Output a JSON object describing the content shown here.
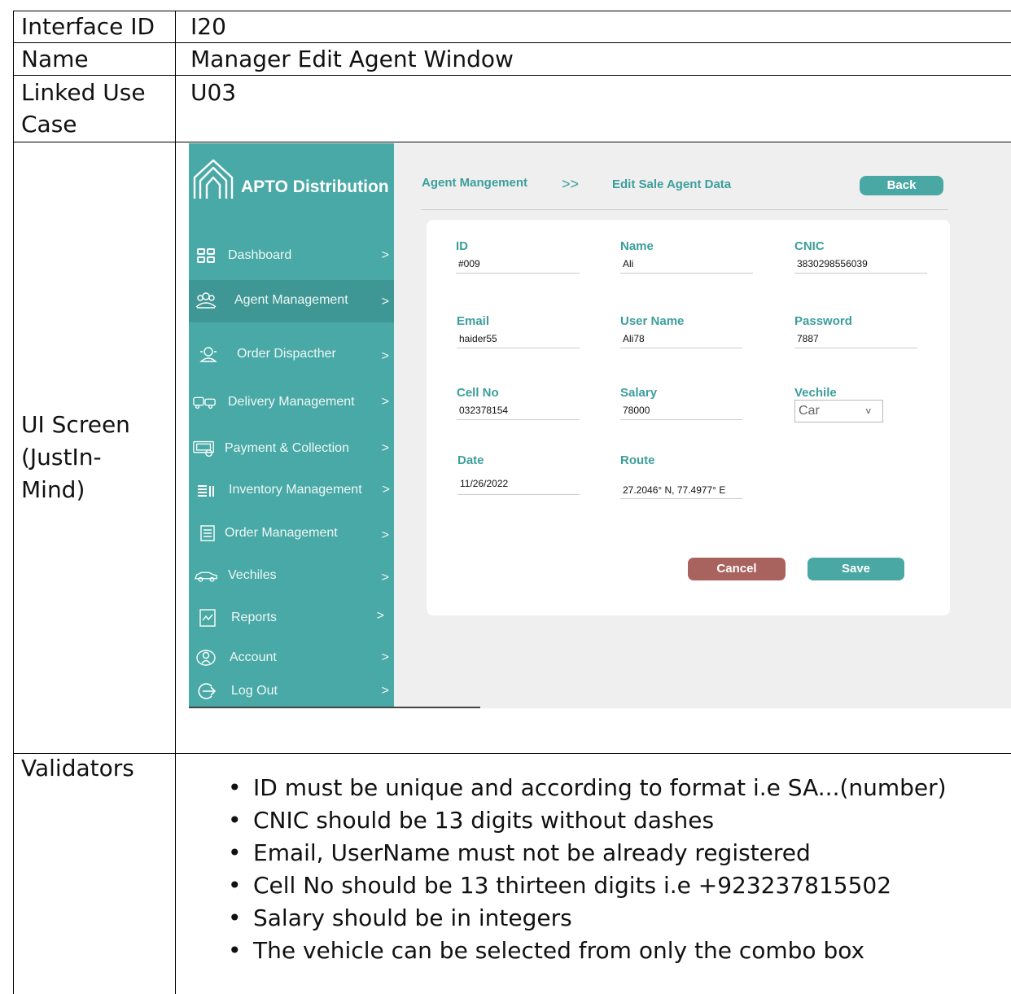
{
  "table": {
    "rows": [
      {
        "label": "Interface ID",
        "value": "I20"
      },
      {
        "label": "Name",
        "value": "Manager Edit Agent Window"
      },
      {
        "label_lines": [
          "Linked Use",
          "Case"
        ],
        "value": "U03"
      },
      {
        "label_lines": [
          "UI Screen",
          "(JustIn-",
          "Mind)"
        ]
      },
      {
        "label": "Validators"
      }
    ]
  },
  "app": {
    "brand": "APTO Distribution",
    "nav": [
      {
        "label": "Dashboard",
        "chevron": ">",
        "icon": "dashboard-icon"
      },
      {
        "label": "Agent Management",
        "chevron": ">",
        "icon": "agents-icon",
        "active": true
      },
      {
        "label": "Order Dispacther",
        "chevron": ">",
        "icon": "dispatcher-icon"
      },
      {
        "label": "Delivery Management",
        "chevron": ">",
        "icon": "delivery-icon"
      },
      {
        "label": "Payment & Collection",
        "chevron": ">",
        "icon": "payment-icon"
      },
      {
        "label": "Inventory Management",
        "chevron": ">",
        "icon": "inventory-icon"
      },
      {
        "label": "Order Management",
        "chevron": ">",
        "icon": "orders-icon"
      },
      {
        "label": "Vechiles",
        "chevron": ">",
        "icon": "car-icon"
      },
      {
        "label": "Reports",
        "chevron": ">",
        "icon": "reports-icon"
      },
      {
        "label": "Account",
        "chevron": ">",
        "icon": "account-icon"
      },
      {
        "label": "Log Out",
        "chevron": ">",
        "icon": "logout-icon"
      }
    ],
    "breadcrumb": {
      "parent": "Agent Mangement",
      "separator": ">>",
      "current": "Edit Sale Agent Data"
    },
    "back_label": "Back",
    "fields": {
      "id": {
        "label": "ID",
        "value": "#009"
      },
      "name": {
        "label": "Name",
        "value": "Ali"
      },
      "cnic": {
        "label": "CNIC",
        "value": "3830298556039"
      },
      "email": {
        "label": "Email",
        "value": "haider55"
      },
      "username": {
        "label": "User Name",
        "value": "Ali78"
      },
      "password": {
        "label": "Password",
        "value": "7887"
      },
      "cell": {
        "label": "Cell No",
        "value": "032378154"
      },
      "salary": {
        "label": "Salary",
        "value": "78000"
      },
      "vehicle": {
        "label": "Vechile",
        "value": "Car",
        "chevron": "v"
      },
      "date": {
        "label": "Date",
        "value": "11/26/2022"
      },
      "route": {
        "label": "Route",
        "value": "27.2046° N, 77.4977° E"
      }
    },
    "cancel_label": "Cancel",
    "save_label": "Save",
    "colors": {
      "teal": "#49a9a6",
      "cancel": "#a8635f",
      "panel_bg": "#efefef"
    }
  },
  "validators": [
    "ID must be unique and according to format i.e SA...(number)",
    "CNIC should be 13 digits without dashes",
    "Email, UserName must not be already registered",
    "Cell No should be 13 thirteen digits i.e +923237815502",
    "Salary should be in integers",
    "The vehicle can be selected from only the combo box"
  ]
}
